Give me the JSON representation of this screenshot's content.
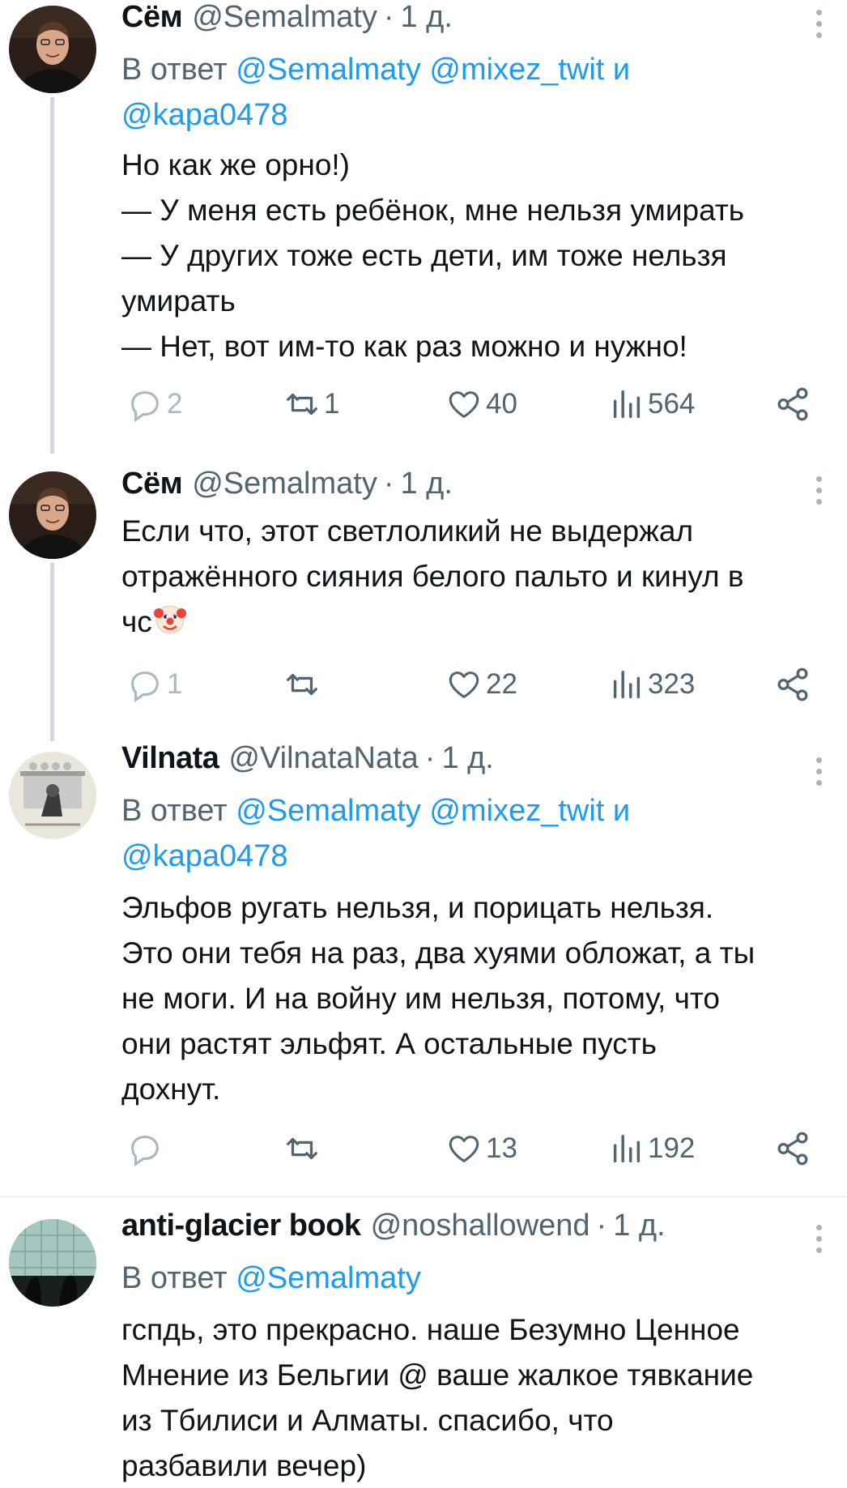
{
  "tweets": [
    {
      "name": "Сём",
      "handle": "@Semalmaty",
      "dot": "·",
      "time": "1 д.",
      "reply_prefix": "В ответ",
      "reply_mentions_line1": "@Semalmaty @mixez_twit",
      "reply_and": "и",
      "reply_mentions_line2": "@kapa0478",
      "lines": [
        "Но как же орно!)",
        "— У меня есть ребёнок, мне нельзя умирать",
        "— У других тоже есть дети, им тоже нельзя",
        "умирать",
        "— Нет, вот им-то как раз можно и нужно!"
      ],
      "replies": "2",
      "retweets": "1",
      "likes": "40",
      "views": "564",
      "avatar_icon": "person-avatar-icon"
    },
    {
      "name": "Сём",
      "handle": "@Semalmaty",
      "dot": "·",
      "time": "1 д.",
      "lines": [
        "Если что, этот светлоликий не выдержал",
        "отражённого сияния белого пальто и кинул в",
        "чс"
      ],
      "emoji": "clown-face-icon",
      "replies": "1",
      "retweets": "",
      "likes": "22",
      "views": "323",
      "avatar_icon": "person-avatar-icon"
    },
    {
      "name": "Vilnata",
      "handle": "@VilnataNata",
      "dot": "·",
      "time": "1 д.",
      "reply_prefix": "В ответ",
      "reply_mentions_line1": "@Semalmaty @mixez_twit",
      "reply_and": "и",
      "reply_mentions_line2": "@kapa0478",
      "lines": [
        "Эльфов ругать нельзя, и порицать нельзя.",
        "Это они тебя на раз, два хуями обложат, а ты",
        "не моги. И на войну им нельзя, потому, что",
        "они растят эльфят. А остальные пусть",
        "дохнут."
      ],
      "replies": "",
      "retweets": "",
      "likes": "13",
      "views": "192",
      "avatar_icon": "drawing-avatar-icon"
    },
    {
      "name": "anti-glacier book",
      "handle": "@noshallowend",
      "dot": "·",
      "time": "1 д.",
      "reply_prefix": "В ответ",
      "reply_mentions_line1": "@Semalmaty",
      "lines": [
        "гспдь, это прекрасно. наше Безумно Ценное",
        "Мнение из Бельгии @ ваше жалкое тявкание",
        "из Тбилиси и Алматы. спасибо, что",
        "разбавили вечер)"
      ],
      "avatar_icon": "glacier-avatar-icon"
    }
  ],
  "colors": {
    "link": "#1d9bf0",
    "secondary": "#536471",
    "text": "#0f1419",
    "thread_line": "#cfd9de"
  }
}
